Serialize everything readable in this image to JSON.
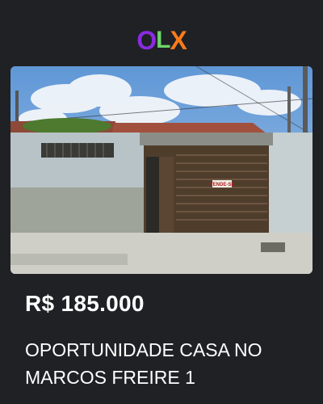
{
  "brand": {
    "logo_text": "OLX",
    "logo_letters": [
      "O",
      "L",
      "X"
    ],
    "colors": {
      "o": "#8a2be2",
      "l": "#6fd46b",
      "x": "#ff7a1a"
    }
  },
  "listing": {
    "image_alt": "house photo",
    "gate_sign": "VENDE-SE",
    "price": "R$ 185.000",
    "title": "OPORTUNIDADE CASA NO MARCOS FREIRE 1"
  },
  "colors": {
    "background": "#1f2125",
    "text": "#ffffff"
  }
}
